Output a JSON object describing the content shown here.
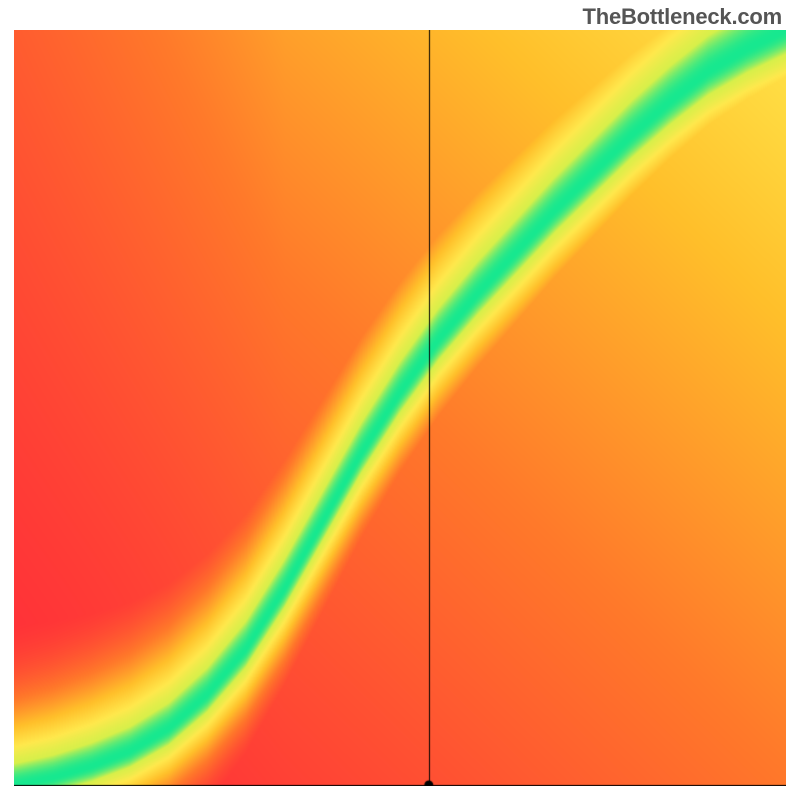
{
  "watermark": "TheBottleneck.com",
  "chart_data": {
    "type": "heatmap",
    "title": "",
    "xlabel": "",
    "ylabel": "",
    "xlim": [
      0,
      1
    ],
    "ylim": [
      0,
      1
    ],
    "grid": false,
    "legend": false,
    "colormap_stops": [
      {
        "t": 0.0,
        "color": "#ff2b3a"
      },
      {
        "t": 0.35,
        "color": "#ff7a2a"
      },
      {
        "t": 0.6,
        "color": "#ffbf2a"
      },
      {
        "t": 0.8,
        "color": "#ffe94d"
      },
      {
        "t": 0.93,
        "color": "#d8f04a"
      },
      {
        "t": 1.0,
        "color": "#17e890"
      }
    ],
    "ridge": {
      "description": "Optimal CPU-GPU balance curve; x is CPU score (normalized), y is GPU score (normalized). Green band along this curve, fading through yellow/orange to red with distance.",
      "sigma": 0.055,
      "asymmetry_top": 1.6,
      "points": [
        {
          "x": 0.0,
          "y": 0.0
        },
        {
          "x": 0.05,
          "y": 0.01
        },
        {
          "x": 0.1,
          "y": 0.025
        },
        {
          "x": 0.15,
          "y": 0.045
        },
        {
          "x": 0.2,
          "y": 0.075
        },
        {
          "x": 0.25,
          "y": 0.12
        },
        {
          "x": 0.3,
          "y": 0.18
        },
        {
          "x": 0.35,
          "y": 0.26
        },
        {
          "x": 0.4,
          "y": 0.35
        },
        {
          "x": 0.45,
          "y": 0.44
        },
        {
          "x": 0.5,
          "y": 0.52
        },
        {
          "x": 0.55,
          "y": 0.59
        },
        {
          "x": 0.6,
          "y": 0.65
        },
        {
          "x": 0.65,
          "y": 0.705
        },
        {
          "x": 0.7,
          "y": 0.76
        },
        {
          "x": 0.75,
          "y": 0.81
        },
        {
          "x": 0.8,
          "y": 0.86
        },
        {
          "x": 0.85,
          "y": 0.905
        },
        {
          "x": 0.9,
          "y": 0.945
        },
        {
          "x": 0.95,
          "y": 0.975
        },
        {
          "x": 1.0,
          "y": 1.0
        }
      ]
    },
    "marker": {
      "x": 0.538,
      "y": 0.0
    },
    "crosshair": {
      "x": 0.538,
      "y": 0.0
    }
  }
}
